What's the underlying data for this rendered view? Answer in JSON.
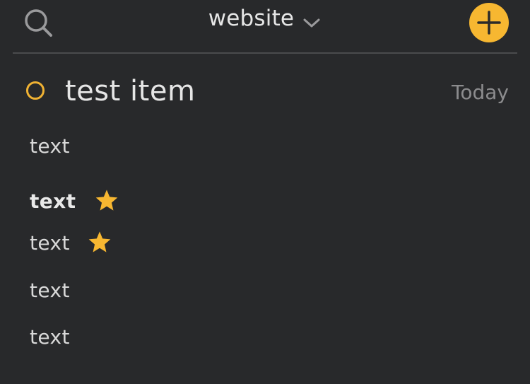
{
  "header": {
    "title": "website",
    "search_icon": "search-icon",
    "dropdown_icon": "chevron-down-icon",
    "add_icon": "plus-icon"
  },
  "task": {
    "title": "test item",
    "date": "Today"
  },
  "lines": [
    {
      "text": "text",
      "bold": false,
      "starred": false
    },
    {
      "text": "text",
      "bold": true,
      "starred": true
    },
    {
      "text": "text",
      "bold": false,
      "starred": true
    },
    {
      "text": "text",
      "bold": false,
      "starred": false
    },
    {
      "text": "text",
      "bold": false,
      "starred": false
    }
  ],
  "colors": {
    "background": "#28292b",
    "accent": "#f7b731",
    "text": "#d9d9d9",
    "muted": "#8c8c8e"
  }
}
